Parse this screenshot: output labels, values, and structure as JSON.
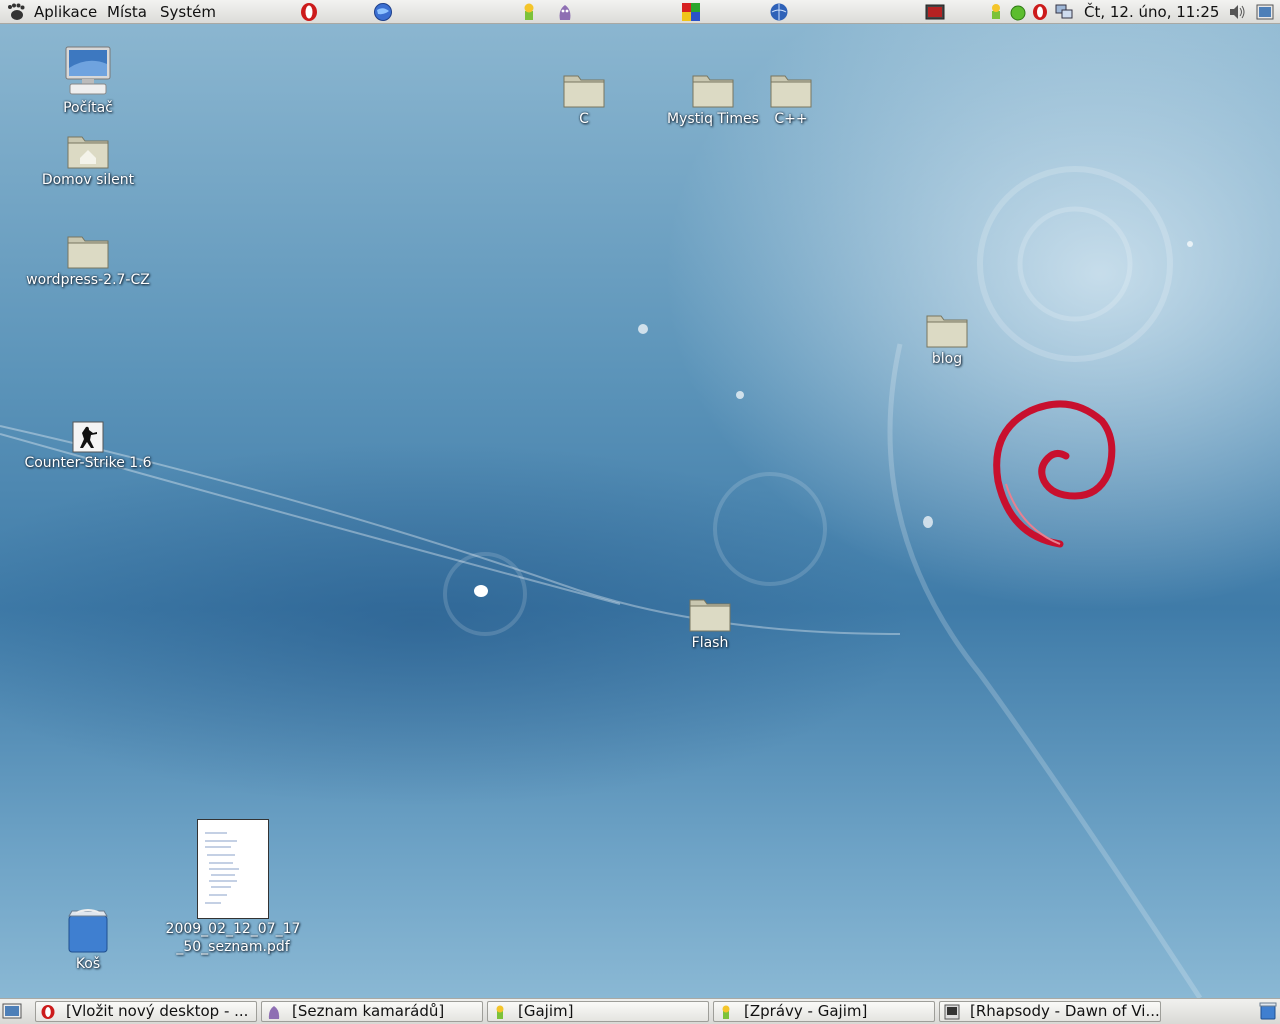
{
  "top_panel": {
    "menus": [
      "Aplikace",
      "Místa",
      "Systém"
    ],
    "launchers": [
      "opera-icon",
      "globe-browser-icon",
      "gajim-icon",
      "pidgin-icon",
      "color-squares-icon",
      "network-globe-icon",
      "presentation-icon"
    ],
    "tray": [
      "gajim-status-icon",
      "green-status-icon",
      "opera-mail-icon",
      "network-monitor-icon"
    ],
    "clock": "Čt, 12. úno, 11:25",
    "volume": "volume-icon"
  },
  "desktop": {
    "icons": {
      "computer": "Počítač",
      "home": "Domov silent",
      "wordpress": "wordpress-2.7-CZ",
      "counter_strike": "Counter-Strike 1.6",
      "trash": "Koš",
      "pdf": "2009_02_12_07_17_50_seznam.pdf",
      "c": "C",
      "mystiq": "Mystiq Times",
      "cpp": "C++",
      "blog": "blog",
      "flash": "Flash"
    }
  },
  "taskbar": {
    "tasks": [
      {
        "label": "[Vložit nový desktop - ...",
        "icon": "opera-icon"
      },
      {
        "label": "[Seznam kamarádů]",
        "icon": "pidgin-icon"
      },
      {
        "label": "[Gajim]",
        "icon": "gajim-icon"
      },
      {
        "label": "[Zprávy - Gajim]",
        "icon": "gajim-icon"
      },
      {
        "label": "[Rhapsody - Dawn of Vi...",
        "icon": "terminal-icon"
      }
    ]
  },
  "colors": {
    "debian_swirl": "#c8102e",
    "desktop_blue": "#3f7ba8",
    "panel": "#e6e6e3"
  }
}
